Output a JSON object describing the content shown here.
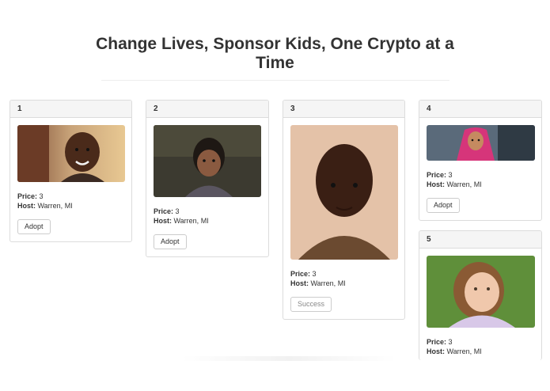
{
  "page": {
    "title": "Change Lives, Sponsor Kids, One Crypto at a Time"
  },
  "labels": {
    "price": "Price:",
    "host": "Host:"
  },
  "cards": [
    {
      "number": "1",
      "price": "3",
      "host": "Warren, MI",
      "button": "Adopt"
    },
    {
      "number": "2",
      "price": "3",
      "host": "Warren, MI",
      "button": "Adopt"
    },
    {
      "number": "3",
      "price": "3",
      "host": "Warren, MI",
      "button": "Success"
    },
    {
      "number": "4",
      "price": "3",
      "host": "Warren, MI",
      "button": "Adopt"
    },
    {
      "number": "5",
      "price": "3",
      "host": "Warren, MI"
    }
  ],
  "colors": {
    "card_border": "#dcdcdc",
    "card_header_bg": "#f5f5f5",
    "text": "#333333"
  }
}
